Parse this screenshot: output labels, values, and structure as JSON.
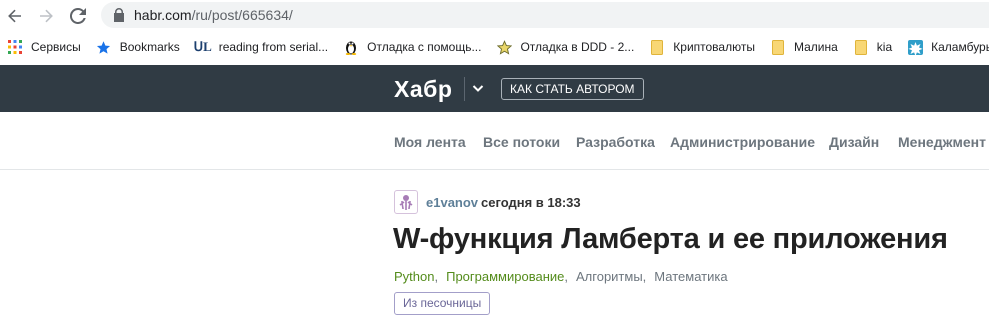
{
  "browser": {
    "url_host": "habr.com",
    "url_path": "/ru/post/665634/"
  },
  "bookmarks": [
    {
      "label": "Сервисы",
      "icon": "apps-grid-icon"
    },
    {
      "label": "Bookmarks",
      "icon": "star-icon"
    },
    {
      "label": "reading from serial...",
      "icon": "ul-logo-icon"
    },
    {
      "label": "Отладка с помощь...",
      "icon": "linux-penguin-icon"
    },
    {
      "label": "Отладка в DDD - 2...",
      "icon": "star-outline-icon"
    },
    {
      "label": "Криптовалюты",
      "icon": "folder-icon"
    },
    {
      "label": "Малина",
      "icon": "folder-icon"
    },
    {
      "label": "kia",
      "icon": "folder-icon"
    },
    {
      "label": "Каламбуры",
      "icon": "puzzle-icon"
    }
  ],
  "header": {
    "logo": "Хабр",
    "author_button": "КАК СТАТЬ АВТОРОМ",
    "background": "#303b44"
  },
  "flows": [
    "Моя лента",
    "Все потоки",
    "Разработка",
    "Администрирование",
    "Дизайн",
    "Менеджмент"
  ],
  "post": {
    "author": "e1vanov",
    "date": "сегодня в 18:33",
    "title": "W-функция Ламберта и ее приложения",
    "hubs": [
      {
        "label": "Python",
        "subscribed": true
      },
      {
        "label": "Программирование",
        "subscribed": true
      },
      {
        "label": "Алгоритмы",
        "subscribed": false
      },
      {
        "label": "Математика",
        "subscribed": false
      }
    ],
    "badge": "Из песочницы"
  }
}
